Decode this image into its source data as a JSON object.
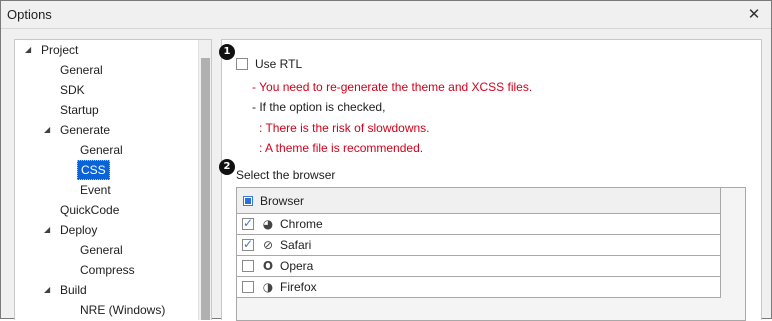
{
  "window": {
    "title": "Options",
    "close_glyph": "✕"
  },
  "tree": {
    "items": [
      {
        "label": "Project",
        "level": 0,
        "expanded": true
      },
      {
        "label": "General",
        "level": 1
      },
      {
        "label": "SDK",
        "level": 1
      },
      {
        "label": "Startup",
        "level": 1
      },
      {
        "label": "Generate",
        "level": 1,
        "expanded": true
      },
      {
        "label": "General",
        "level": 2
      },
      {
        "label": "CSS",
        "level": 2,
        "selected": true
      },
      {
        "label": "Event",
        "level": 2
      },
      {
        "label": "QuickCode",
        "level": 1
      },
      {
        "label": "Deploy",
        "level": 1,
        "expanded": true
      },
      {
        "label": "General",
        "level": 2
      },
      {
        "label": "Compress",
        "level": 2
      },
      {
        "label": "Build",
        "level": 1,
        "expanded": true
      },
      {
        "label": "NRE (Windows)",
        "level": 2
      }
    ]
  },
  "options": {
    "badge1": "1",
    "badge2": "2",
    "use_rtl_label": "Use RTL",
    "use_rtl_checked": false,
    "note_regenerate": "- You need to re-generate the theme and XCSS files.",
    "note_if_checked": "- If the option is checked,",
    "note_slowdowns": ": There is the risk of slowdowns.",
    "note_theme": ": A theme file is recommended.",
    "select_browser_label": "Select the browser"
  },
  "browser_grid": {
    "header": "Browser",
    "rows": [
      {
        "name": "Chrome",
        "checked": true,
        "icon": "chrome-icon",
        "glyph": "◕"
      },
      {
        "name": "Safari",
        "checked": true,
        "icon": "safari-icon",
        "glyph": "⊘"
      },
      {
        "name": "Opera",
        "checked": false,
        "icon": "opera-icon",
        "glyph": "O"
      },
      {
        "name": "Firefox",
        "checked": false,
        "icon": "firefox-icon",
        "glyph": "◑"
      }
    ]
  },
  "colors": {
    "accent": "#0a64d8",
    "warning": "#d0021b"
  }
}
